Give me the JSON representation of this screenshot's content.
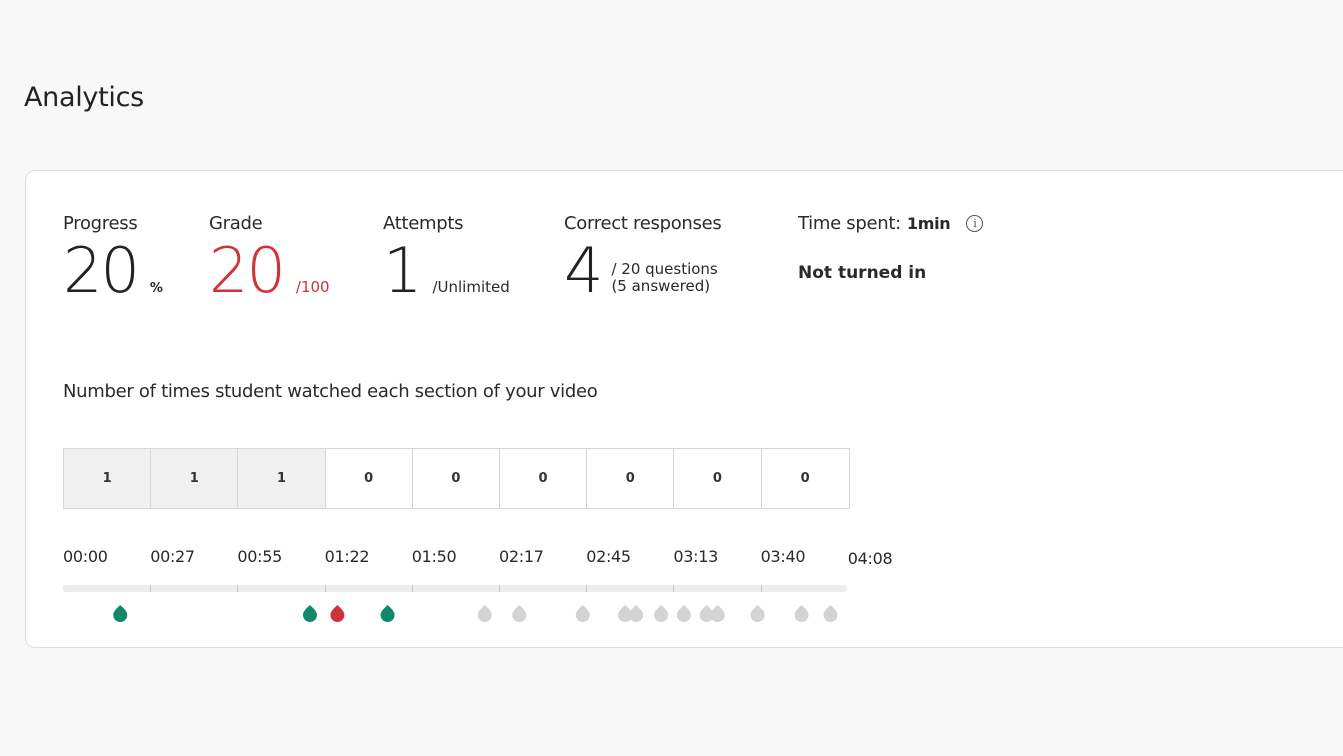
{
  "header": {
    "title": "Analytics"
  },
  "stats": {
    "progress": {
      "label": "Progress",
      "value": "20",
      "unit": "%"
    },
    "grade": {
      "label": "Grade",
      "value": "20",
      "unit": "/100"
    },
    "attempts": {
      "label": "Attempts",
      "value": "1",
      "unit": "/Unlimited"
    },
    "correct": {
      "label": "Correct responses",
      "value": "4",
      "unit_line1": "/ 20 questions",
      "unit_line2": "(5 answered)"
    },
    "time_spent": {
      "label": "Time spent:",
      "value": "1min",
      "info_icon": "info-icon"
    },
    "status": "Not turned in"
  },
  "video_chart": {
    "caption": "Number of times student watched each section of your video",
    "sections": [
      "1",
      "1",
      "1",
      "0",
      "0",
      "0",
      "0",
      "0",
      "0"
    ],
    "timestamps": [
      "00:00",
      "00:27",
      "00:55",
      "01:22",
      "01:50",
      "02:17",
      "02:45",
      "03:13",
      "03:40",
      "04:08"
    ],
    "question_markers": {
      "colors": {
        "correct": "#0e8a6a",
        "incorrect": "#d0323a",
        "unanswered": "#d3d3d3"
      },
      "markers": [
        {
          "status": "correct",
          "time_fraction": 0.073
        },
        {
          "status": "correct",
          "time_fraction": 0.315
        },
        {
          "status": "incorrect",
          "time_fraction": 0.35
        },
        {
          "status": "correct",
          "time_fraction": 0.414
        },
        {
          "status": "unanswered",
          "time_fraction": 0.538
        },
        {
          "status": "unanswered",
          "time_fraction": 0.582
        },
        {
          "status": "unanswered",
          "time_fraction": 0.663
        },
        {
          "status": "unanswered",
          "time_fraction": 0.717
        },
        {
          "status": "unanswered",
          "time_fraction": 0.731
        },
        {
          "status": "unanswered",
          "time_fraction": 0.763
        },
        {
          "status": "unanswered",
          "time_fraction": 0.792
        },
        {
          "status": "unanswered",
          "time_fraction": 0.821
        },
        {
          "status": "unanswered",
          "time_fraction": 0.835
        },
        {
          "status": "unanswered",
          "time_fraction": 0.886
        },
        {
          "status": "unanswered",
          "time_fraction": 0.942
        },
        {
          "status": "unanswered",
          "time_fraction": 0.979
        }
      ]
    }
  }
}
